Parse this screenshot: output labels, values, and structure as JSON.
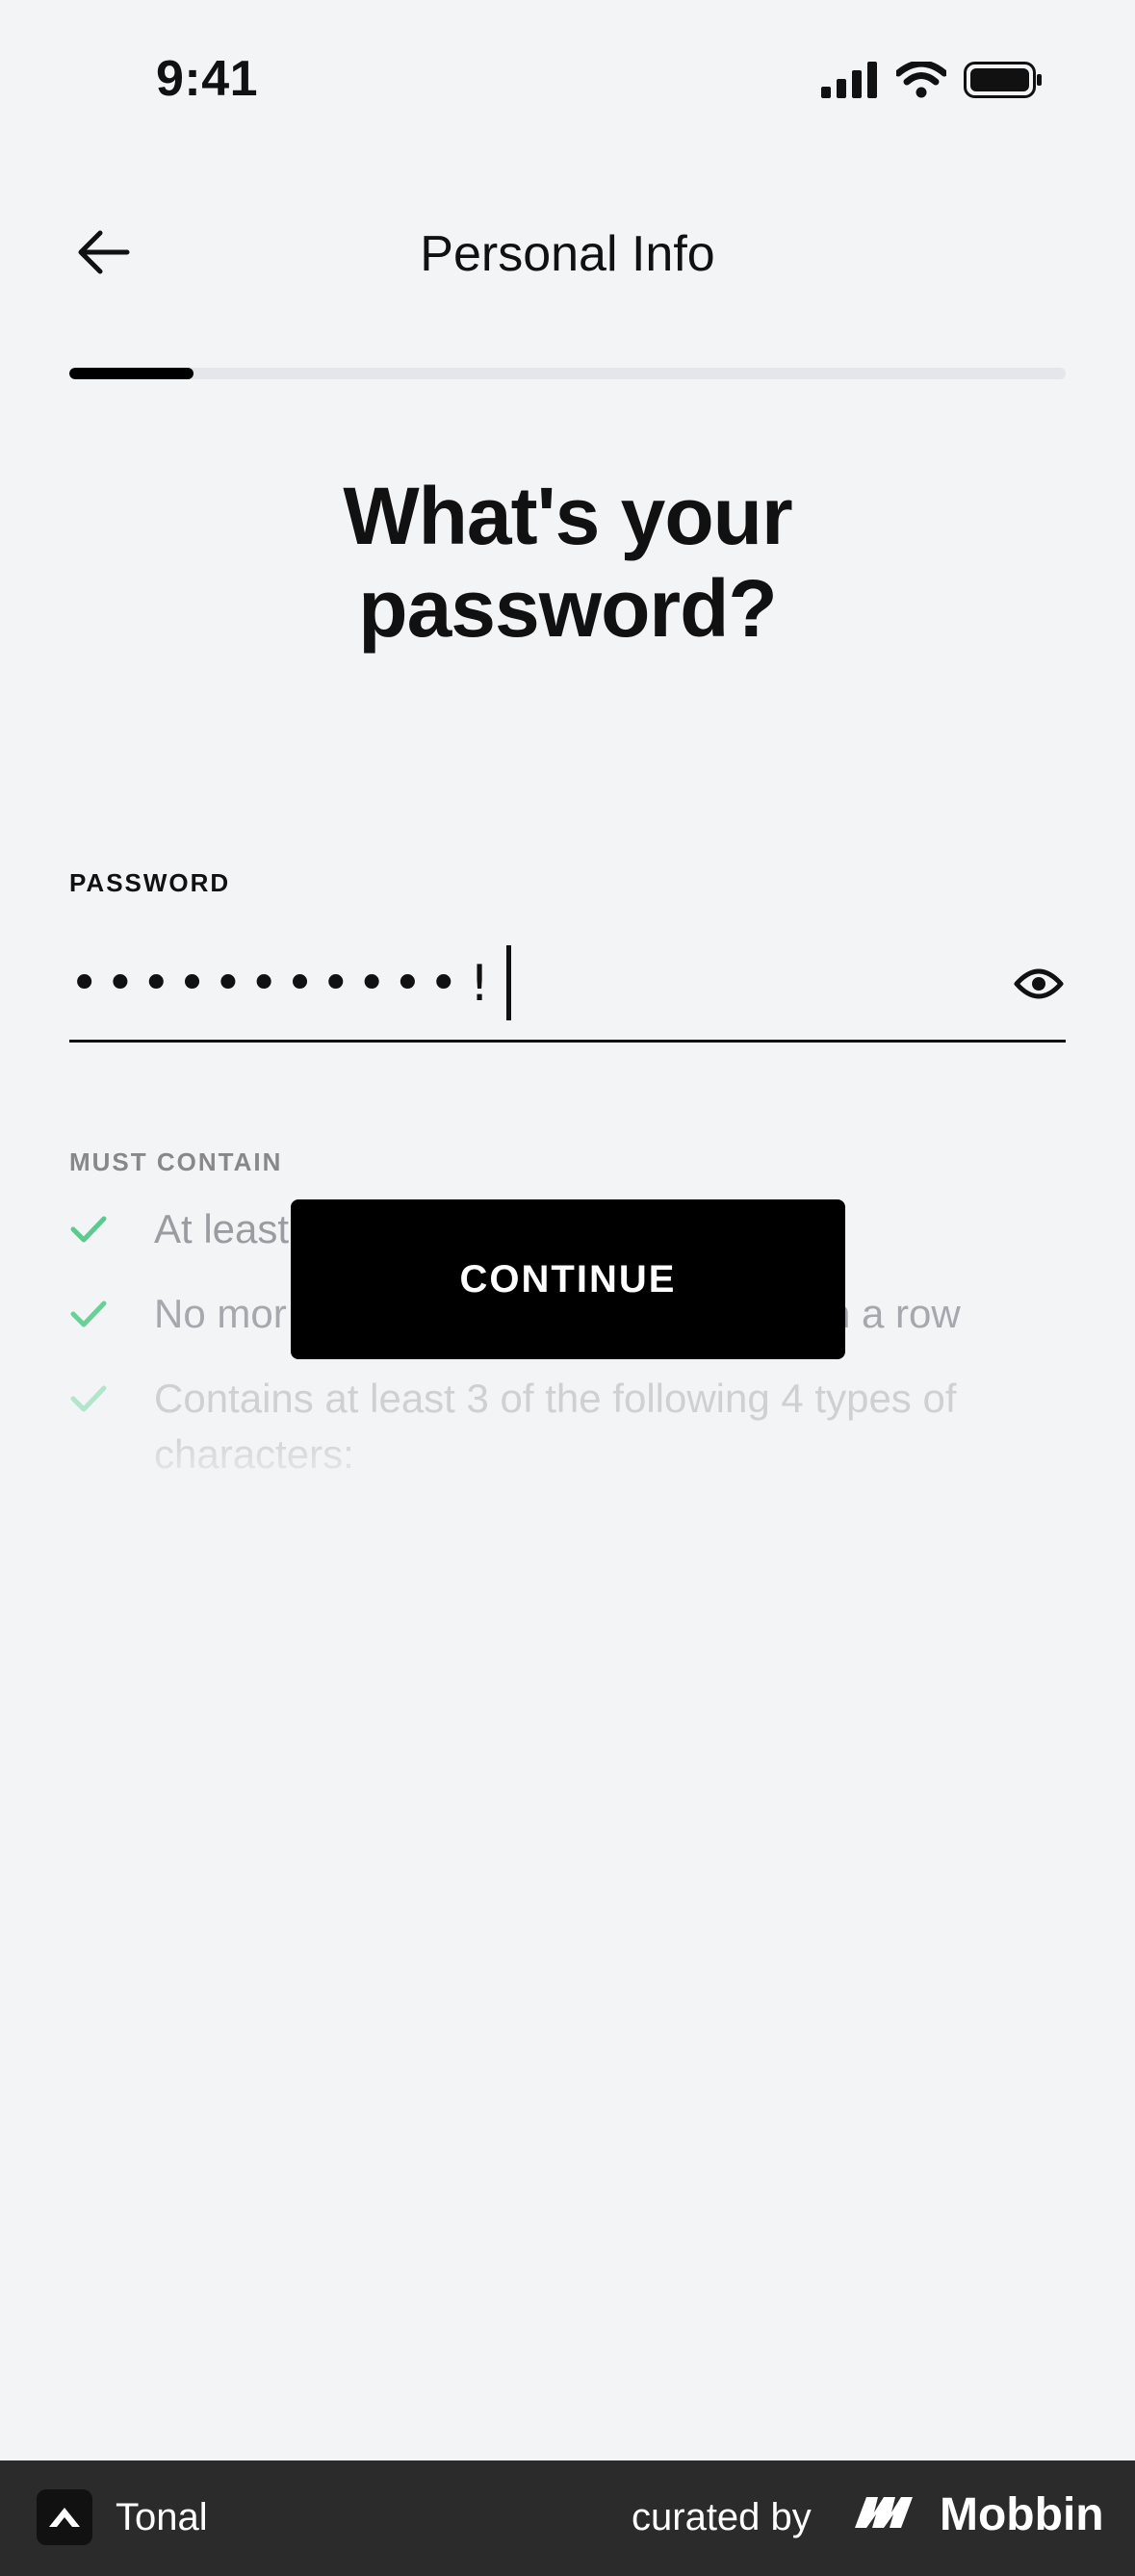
{
  "status_bar": {
    "time": "9:41"
  },
  "header": {
    "title": "Personal Info"
  },
  "progress": {
    "fraction": 0.125
  },
  "main": {
    "heading_line1": "What's your",
    "heading_line2": "password?",
    "password": {
      "label": "PASSWORD",
      "masked_value": "•••••••••••!"
    },
    "requirements": {
      "label": "MUST CONTAIN",
      "items": [
        {
          "text": "At least"
        },
        {
          "text": "No mor",
          "text_tail": "n a row"
        },
        {
          "text": "Contains at least 3 of the following 4 types of characters:"
        }
      ]
    },
    "continue_label": "CONTINUE"
  },
  "footer": {
    "app_name": "Tonal",
    "curated_by": "curated by",
    "brand": "Mobbin"
  },
  "colors": {
    "check": "#5cc98f",
    "button": "#000000",
    "background": "#f3f4f6"
  },
  "icons": [
    "signal-icon",
    "wifi-icon",
    "battery-icon",
    "back-arrow-icon",
    "eye-icon",
    "check-icon",
    "tonal-logo-icon",
    "mobbin-logo-icon"
  ]
}
